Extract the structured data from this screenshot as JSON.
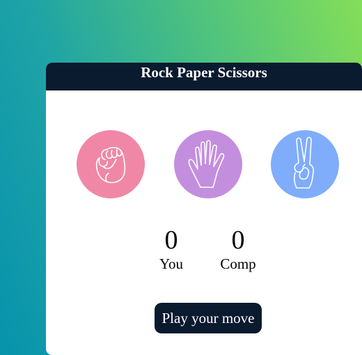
{
  "header": {
    "title": "Rock Paper Scissors"
  },
  "choices": [
    {
      "name": "rock",
      "icon": "fist-icon",
      "color": "#f087a6"
    },
    {
      "name": "paper",
      "icon": "open-hand-icon",
      "color": "#c48ede"
    },
    {
      "name": "scissors",
      "icon": "peace-hand-icon",
      "color": "#7fadfc"
    }
  ],
  "scores": {
    "you": {
      "value": "0",
      "label": "You"
    },
    "comp": {
      "value": "0",
      "label": "Comp"
    }
  },
  "actions": {
    "play_label": "Play your move"
  },
  "colors": {
    "header_bg": "#0a1a2f",
    "card_bg": "#ffffff",
    "gradient_start": "#0893ad",
    "gradient_end": "#84de57"
  }
}
